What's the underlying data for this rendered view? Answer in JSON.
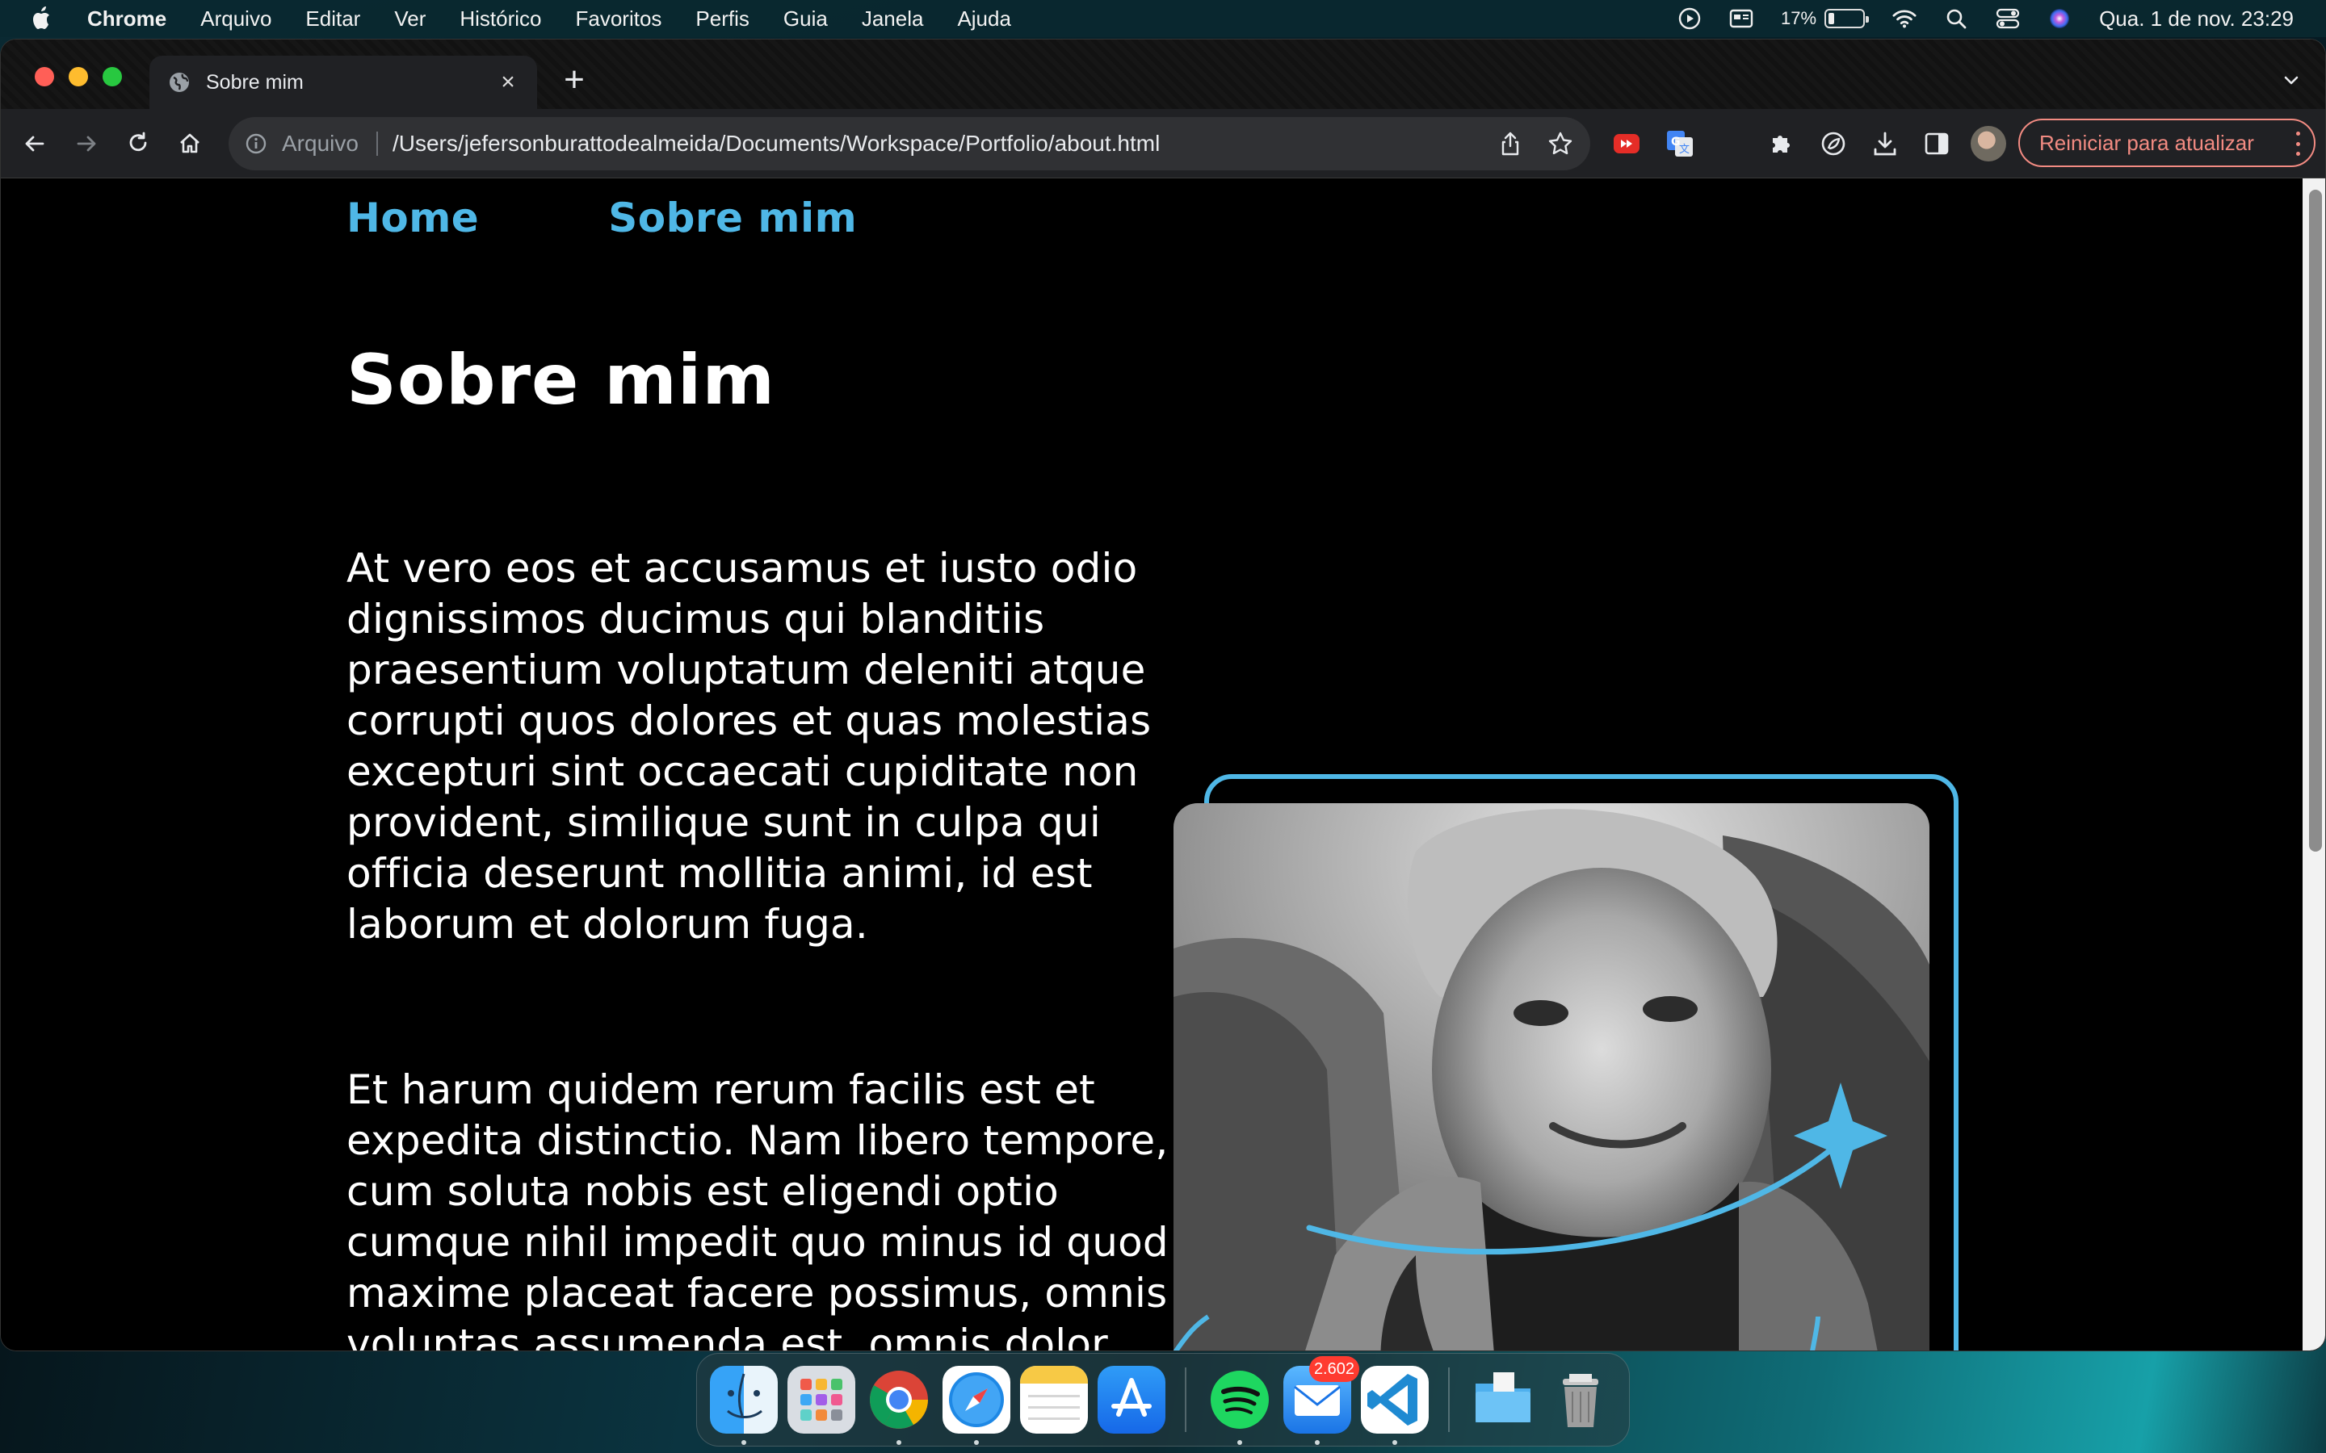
{
  "menubar": {
    "app_name": "Chrome",
    "menus": [
      "Arquivo",
      "Editar",
      "Ver",
      "Histórico",
      "Favoritos",
      "Perfis",
      "Guia",
      "Janela",
      "Ajuda"
    ],
    "battery_percent": "17%",
    "battery_level": 0.17,
    "clock": "Qua. 1 de nov.  23:29"
  },
  "browser": {
    "tab_title": "Sobre mim",
    "new_tab_symbol": "+",
    "close_symbol": "×",
    "url_scheme": "Arquivo",
    "url": "/Users/jefersonburattodealmeida/Documents/Workspace/Portfolio/about.html",
    "relaunch_label": "Reiniciar para atualizar"
  },
  "site": {
    "nav": [
      {
        "label": "Home"
      },
      {
        "label": "Sobre mim"
      }
    ],
    "title": "Sobre mim",
    "paragraphs": [
      "At vero eos et accusamus et iusto odio dignissimos ducimus qui blanditiis praesentium voluptatum deleniti atque corrupti quos dolores et quas molestias excepturi sint occaecati cupiditate non provident, similique sunt in culpa qui officia deserunt mollitia animi, id est laborum et dolorum fuga.",
      "Et harum quidem rerum facilis est et expedita distinctio. Nam libero tempore, cum soluta nobis est eligendi optio cumque nihil impedit quo minus id quod maxime placeat facere possimus, omnis voluptas assumenda est, omnis dolor repellendus."
    ],
    "accent_color": "#4fb7e6"
  },
  "dock": {
    "mail_badge": "2.602"
  }
}
